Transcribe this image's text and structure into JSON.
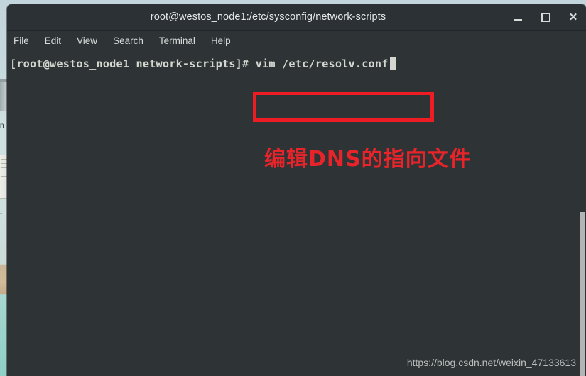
{
  "window": {
    "title": "root@westos_node1:/etc/sysconfig/network-scripts",
    "controls": {
      "minimize_label": "_",
      "maximize_label": "",
      "close_label": "✕"
    }
  },
  "menu": {
    "items": [
      {
        "label": "File"
      },
      {
        "label": "Edit"
      },
      {
        "label": "View"
      },
      {
        "label": "Search"
      },
      {
        "label": "Terminal"
      },
      {
        "label": "Help"
      }
    ]
  },
  "terminal": {
    "prompt": "[root@westos_node1 network-scripts]# vim /etc/resolv.conf",
    "prompt_user_host_path": "[root@westos_node1 network-scripts]",
    "prompt_symbol": "#",
    "command": "vim /etc/resolv.conf",
    "cursor": "block"
  },
  "annotations": {
    "highlight_color": "#ee1c23",
    "note_text": "编辑DNS的指向文件",
    "note_color": "#e8242a"
  },
  "watermark": {
    "text": "https://blog.csdn.net/weixin_47133613"
  },
  "desktop": {
    "icon_label_1": "n",
    "icon_label_2": "-"
  },
  "colors": {
    "titlebar_bg": "#2b3134",
    "terminal_bg": "#2e3436",
    "terminal_fg": "#d3d7cf",
    "scrollbar_thumb": "#b2b5b4"
  }
}
